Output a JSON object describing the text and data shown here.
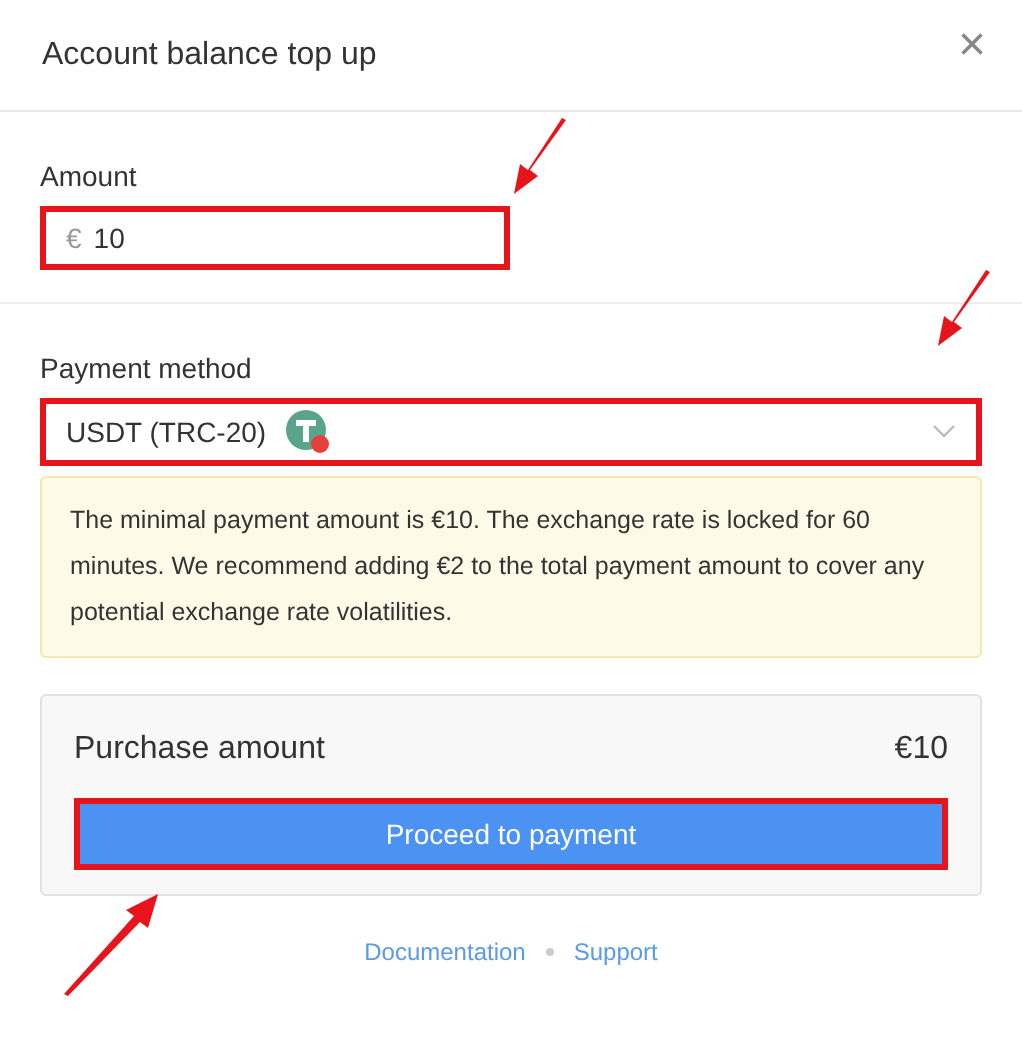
{
  "dialog": {
    "title": "Account balance top up",
    "close": "×"
  },
  "amount": {
    "label": "Amount",
    "currency": "€",
    "value": "10",
    "highlighted": true,
    "arrow": true
  },
  "payment_method": {
    "label": "Payment method",
    "value": "USDT (TRC-20)",
    "highlighted": true,
    "arrow": true
  },
  "notice": "The minimal payment amount is €10. The exchange rate is locked for 60 minutes. We recommend adding €2 to the total payment amount to cover any potential exchange rate volatilities.",
  "summary": {
    "label": "Purchase amount",
    "value": "€10"
  },
  "proceed_button": {
    "label": "Proceed to payment",
    "highlighted": true,
    "arrow": true
  },
  "footer_links": [
    "Documentation",
    "Support"
  ]
}
